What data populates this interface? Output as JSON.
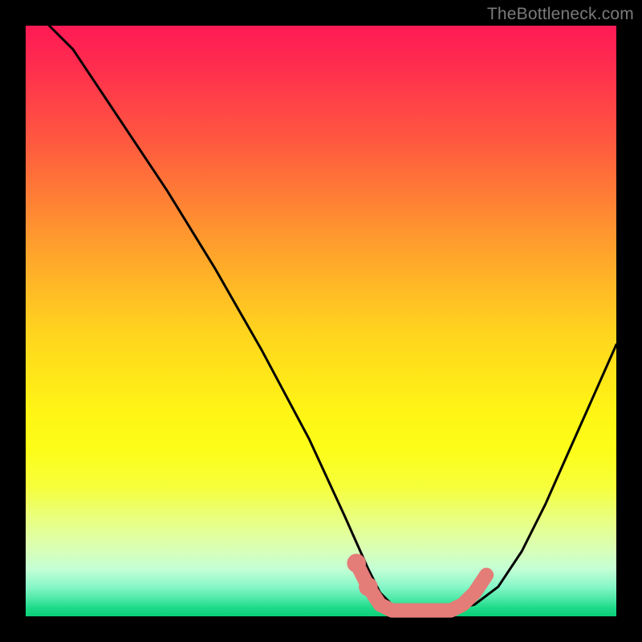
{
  "watermark": "TheBottleneck.com",
  "chart_data": {
    "type": "line",
    "title": "",
    "xlabel": "",
    "ylabel": "",
    "xlim": [
      0,
      100
    ],
    "ylim": [
      0,
      100
    ],
    "series": [
      {
        "name": "black-curve",
        "color": "#000000",
        "x": [
          4,
          8,
          16,
          24,
          32,
          40,
          48,
          54,
          58,
          60,
          62,
          64,
          68,
          72,
          76,
          80,
          84,
          88,
          92,
          96,
          100
        ],
        "values": [
          100,
          96,
          84,
          72,
          59,
          45,
          30,
          17,
          8,
          4,
          2,
          1,
          1,
          1,
          2,
          5,
          11,
          19,
          28,
          37,
          46
        ]
      },
      {
        "name": "pink-band",
        "color": "#e47c78",
        "x": [
          56,
          58,
          60,
          62,
          64,
          66,
          68,
          70,
          72,
          74,
          76,
          78
        ],
        "values": [
          9,
          5,
          2,
          1,
          1,
          1,
          1,
          1,
          1,
          2,
          4,
          7
        ]
      }
    ],
    "markers": [
      {
        "name": "pink-dot-1",
        "x": 56,
        "y": 9,
        "r": 1.6,
        "color": "#e47c78"
      },
      {
        "name": "pink-dot-2",
        "x": 58,
        "y": 5,
        "r": 1.6,
        "color": "#e47c78"
      }
    ]
  }
}
